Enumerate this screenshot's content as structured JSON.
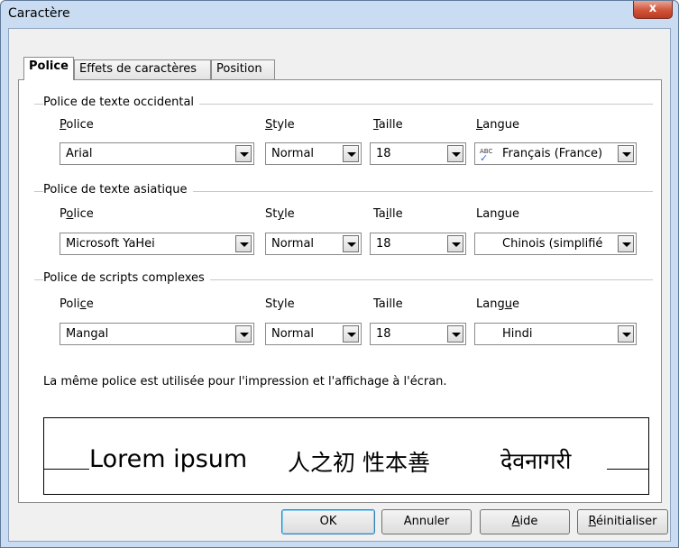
{
  "window": {
    "title": "Caractère",
    "close_label": "x"
  },
  "tabs": [
    {
      "label": "Police",
      "active": true
    },
    {
      "label": "Effets de caractères",
      "active": false
    },
    {
      "label": "Position",
      "active": false
    }
  ],
  "western": {
    "group_title": "Police de texte occidental",
    "font_label": "Police",
    "style_label": "Style",
    "size_label": "Taille",
    "lang_label": "Langue",
    "font_value": "Arial",
    "style_value": "Normal",
    "size_value": "18",
    "lang_value": "Français (France)"
  },
  "asian": {
    "group_title": "Police de texte asiatique",
    "font_label": "Police",
    "style_label": "Style",
    "size_label": "Taille",
    "lang_label": "Langue",
    "font_value": "Microsoft YaHei",
    "style_value": "Normal",
    "size_value": "18",
    "lang_value": "Chinois (simplifié"
  },
  "ctl": {
    "group_title": "Police de scripts complexes",
    "font_label": "Police",
    "style_label": "Style",
    "size_label": "Taille",
    "lang_label": "Langue",
    "font_value": "Mangal",
    "style_value": "Normal",
    "size_value": "18",
    "lang_value": "Hindi"
  },
  "note": "La même police est utilisée pour l'impression et l'affichage à l'écran.",
  "preview": {
    "western": "Lorem ipsum",
    "asian": "人之初 性本善",
    "ctl": "देवनागरी"
  },
  "buttons": {
    "ok": "OK",
    "cancel": "Annuler",
    "help": "Aide",
    "reset": "Réinitialiser"
  },
  "icons": {
    "spell": "ABC"
  }
}
